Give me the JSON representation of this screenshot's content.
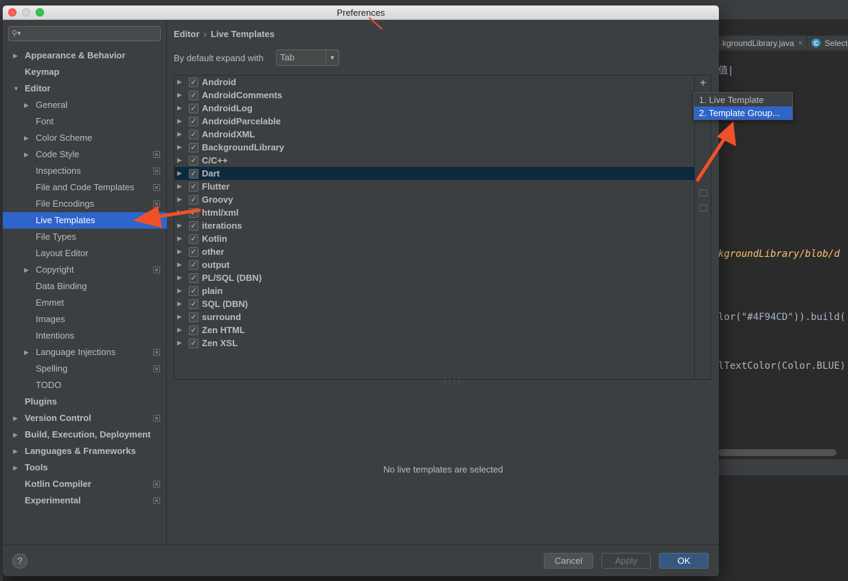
{
  "window": {
    "title": "Preferences"
  },
  "search": {
    "placeholder": ""
  },
  "tree": [
    {
      "label": "Appearance & Behavior",
      "level": 0,
      "arrow": "▶",
      "bold": true,
      "project": false,
      "selected": false
    },
    {
      "label": "Keymap",
      "level": 0,
      "arrow": "",
      "bold": true,
      "project": false,
      "selected": false
    },
    {
      "label": "Editor",
      "level": 0,
      "arrow": "▼",
      "bold": true,
      "project": false,
      "selected": false
    },
    {
      "label": "General",
      "level": 1,
      "arrow": "▶",
      "bold": false,
      "project": false,
      "selected": false
    },
    {
      "label": "Font",
      "level": 1,
      "arrow": "",
      "bold": false,
      "project": false,
      "selected": false
    },
    {
      "label": "Color Scheme",
      "level": 1,
      "arrow": "▶",
      "bold": false,
      "project": false,
      "selected": false
    },
    {
      "label": "Code Style",
      "level": 1,
      "arrow": "▶",
      "bold": false,
      "project": true,
      "selected": false
    },
    {
      "label": "Inspections",
      "level": 1,
      "arrow": "",
      "bold": false,
      "project": true,
      "selected": false
    },
    {
      "label": "File and Code Templates",
      "level": 1,
      "arrow": "",
      "bold": false,
      "project": true,
      "selected": false
    },
    {
      "label": "File Encodings",
      "level": 1,
      "arrow": "",
      "bold": false,
      "project": true,
      "selected": false
    },
    {
      "label": "Live Templates",
      "level": 1,
      "arrow": "",
      "bold": false,
      "project": false,
      "selected": true
    },
    {
      "label": "File Types",
      "level": 1,
      "arrow": "",
      "bold": false,
      "project": false,
      "selected": false
    },
    {
      "label": "Layout Editor",
      "level": 1,
      "arrow": "",
      "bold": false,
      "project": false,
      "selected": false
    },
    {
      "label": "Copyright",
      "level": 1,
      "arrow": "▶",
      "bold": false,
      "project": true,
      "selected": false
    },
    {
      "label": "Data Binding",
      "level": 1,
      "arrow": "",
      "bold": false,
      "project": false,
      "selected": false
    },
    {
      "label": "Emmet",
      "level": 1,
      "arrow": "",
      "bold": false,
      "project": false,
      "selected": false
    },
    {
      "label": "Images",
      "level": 1,
      "arrow": "",
      "bold": false,
      "project": false,
      "selected": false
    },
    {
      "label": "Intentions",
      "level": 1,
      "arrow": "",
      "bold": false,
      "project": false,
      "selected": false
    },
    {
      "label": "Language Injections",
      "level": 1,
      "arrow": "▶",
      "bold": false,
      "project": true,
      "selected": false
    },
    {
      "label": "Spelling",
      "level": 1,
      "arrow": "",
      "bold": false,
      "project": true,
      "selected": false
    },
    {
      "label": "TODO",
      "level": 1,
      "arrow": "",
      "bold": false,
      "project": false,
      "selected": false
    },
    {
      "label": "Plugins",
      "level": 0,
      "arrow": "",
      "bold": true,
      "project": false,
      "selected": false
    },
    {
      "label": "Version Control",
      "level": 0,
      "arrow": "▶",
      "bold": true,
      "project": true,
      "selected": false
    },
    {
      "label": "Build, Execution, Deployment",
      "level": 0,
      "arrow": "▶",
      "bold": true,
      "project": false,
      "selected": false
    },
    {
      "label": "Languages & Frameworks",
      "level": 0,
      "arrow": "▶",
      "bold": true,
      "project": false,
      "selected": false
    },
    {
      "label": "Tools",
      "level": 0,
      "arrow": "▶",
      "bold": true,
      "project": false,
      "selected": false
    },
    {
      "label": "Kotlin Compiler",
      "level": 0,
      "arrow": "",
      "bold": true,
      "project": true,
      "selected": false
    },
    {
      "label": "Experimental",
      "level": 0,
      "arrow": "",
      "bold": true,
      "project": true,
      "selected": false
    }
  ],
  "breadcrumb": {
    "parent": "Editor",
    "separator": "›",
    "current": "Live Templates"
  },
  "expand": {
    "label": "By default expand with",
    "value": "Tab"
  },
  "templates": [
    {
      "name": "Android",
      "checked": true,
      "selected": false
    },
    {
      "name": "AndroidComments",
      "checked": true,
      "selected": false
    },
    {
      "name": "AndroidLog",
      "checked": true,
      "selected": false
    },
    {
      "name": "AndroidParcelable",
      "checked": true,
      "selected": false
    },
    {
      "name": "AndroidXML",
      "checked": true,
      "selected": false
    },
    {
      "name": "BackgroundLibrary",
      "checked": true,
      "selected": false
    },
    {
      "name": "C/C++",
      "checked": true,
      "selected": false
    },
    {
      "name": "Dart",
      "checked": true,
      "selected": true
    },
    {
      "name": "Flutter",
      "checked": true,
      "selected": false
    },
    {
      "name": "Groovy",
      "checked": true,
      "selected": false
    },
    {
      "name": "html/xml",
      "checked": true,
      "selected": false
    },
    {
      "name": "iterations",
      "checked": true,
      "selected": false
    },
    {
      "name": "Kotlin",
      "checked": true,
      "selected": false
    },
    {
      "name": "other",
      "checked": true,
      "selected": false
    },
    {
      "name": "output",
      "checked": true,
      "selected": false
    },
    {
      "name": "PL/SQL (DBN)",
      "checked": true,
      "selected": false
    },
    {
      "name": "plain",
      "checked": true,
      "selected": false
    },
    {
      "name": "SQL (DBN)",
      "checked": true,
      "selected": false
    },
    {
      "name": "surround",
      "checked": true,
      "selected": false
    },
    {
      "name": "Zen HTML",
      "checked": true,
      "selected": false
    },
    {
      "name": "Zen XSL",
      "checked": true,
      "selected": false
    }
  ],
  "toolbar": {
    "add_label": "+"
  },
  "popup": {
    "items": [
      "1. Live Template",
      "2. Template Group..."
    ],
    "selected_index": 1
  },
  "details": {
    "empty_message": "No live templates are selected"
  },
  "footer": {
    "help_label": "?",
    "cancel_label": "Cancel",
    "apply_label": "Apply",
    "ok_label": "OK"
  },
  "background_ide": {
    "tab1": "kgroundLibrary.java",
    "tab1_close": "×",
    "tab2_icon": "C",
    "tab2": "Selector",
    "code_lines": [
      "值|",
      "kgroundLibrary/blob/d",
      "lor(\"#4F94CD\")).build(",
      "lTextColor(Color.BLUE)"
    ]
  },
  "colors": {
    "selection": "#2f65ca",
    "annotation_arrow": "#f0512b",
    "ok_button": "#365880"
  }
}
